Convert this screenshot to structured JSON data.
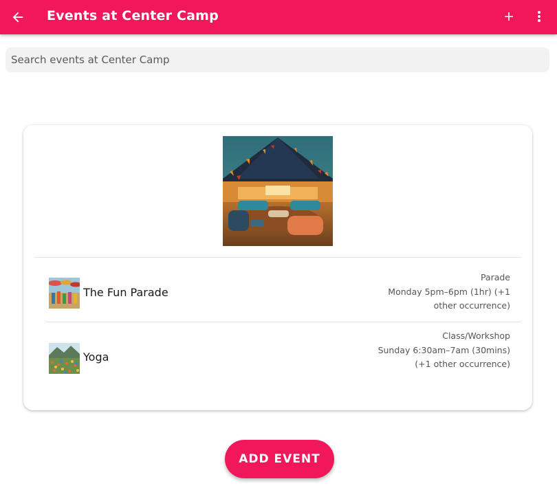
{
  "app_bar": {
    "title": "Events at Center Camp",
    "back_icon": "arrow-left-icon",
    "add_icon": "plus-icon",
    "more_icon": "more-vert-icon",
    "color": "#f0185a"
  },
  "search": {
    "placeholder": "Search events at Center Camp",
    "value": ""
  },
  "camp": {
    "image": "center-camp-tent-image"
  },
  "events": [
    {
      "name": "The Fun Parade",
      "category": "Parade",
      "schedule": "Monday 5pm–6pm (1hr) (+1 other occurrence)",
      "thumbnail": "parade-thumbnail"
    },
    {
      "name": "Yoga",
      "category": "Class/Workshop",
      "schedule": "Sunday 6:30am–7am (30mins) (+1 other occurrence)",
      "thumbnail": "yoga-thumbnail"
    }
  ],
  "add_event_label": "ADD EVENT"
}
